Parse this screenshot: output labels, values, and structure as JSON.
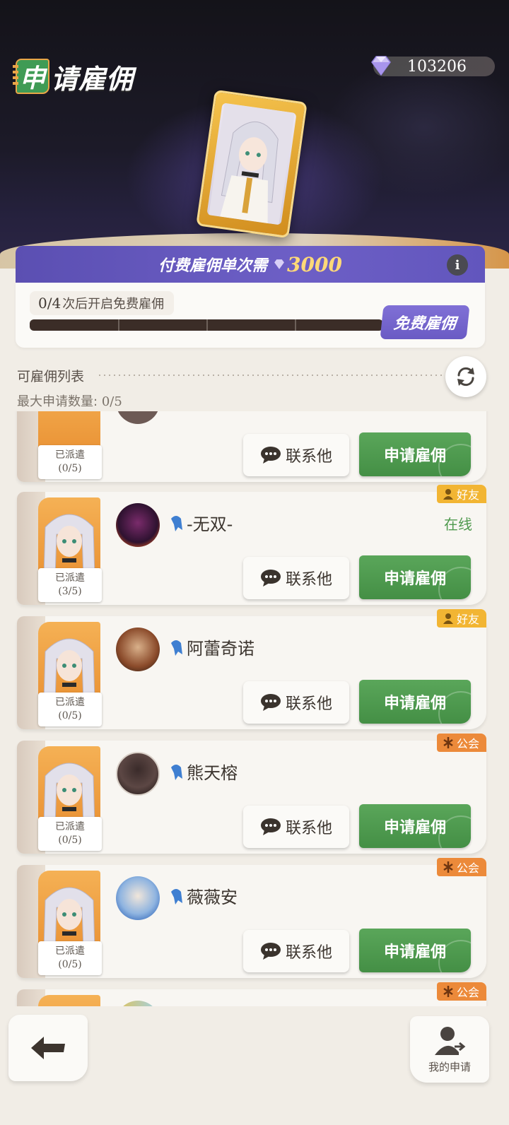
{
  "header": {
    "title_badge_char": "申",
    "title_rest": "请雇佣",
    "currency_value": "103206"
  },
  "fee_bar": {
    "label": "付费雇佣单次需",
    "amount": "3000",
    "info_label": "i"
  },
  "free_hire": {
    "count": "0/4",
    "count_suffix": "次后开启免费雇佣",
    "progress_value": 0,
    "progress_total": 4,
    "button_label": "免费雇佣"
  },
  "list": {
    "title": "可雇佣列表",
    "max_label": "最大申请数量:",
    "max_value": "0/5",
    "dispatched_label": "已派遣",
    "contact_label": "联系他",
    "apply_label": "申请雇佣",
    "rows": [
      {
        "name": "",
        "dispatched": "(0/5)",
        "tag": "",
        "status": ""
      },
      {
        "name": "-无双-",
        "dispatched": "(3/5)",
        "tag": "好友",
        "tag_type": "friend",
        "status": "在线"
      },
      {
        "name": "阿蕾奇诺",
        "dispatched": "(0/5)",
        "tag": "好友",
        "tag_type": "friend",
        "status": ""
      },
      {
        "name": "熊天榕",
        "dispatched": "(0/5)",
        "tag": "公会",
        "tag_type": "guild",
        "status": ""
      },
      {
        "name": "薇薇安",
        "dispatched": "(0/5)",
        "tag": "公会",
        "tag_type": "guild",
        "status": ""
      },
      {
        "name": "",
        "dispatched": "",
        "tag": "公会",
        "tag_type": "guild",
        "status": ""
      }
    ]
  },
  "bottom": {
    "my_apply_label": "我的申请"
  },
  "colors": {
    "accent_purple": "#6a5bc4",
    "apply_green": "#4f9a4e",
    "friend_tag": "#f2b533",
    "guild_tag": "#ec8a3a"
  }
}
